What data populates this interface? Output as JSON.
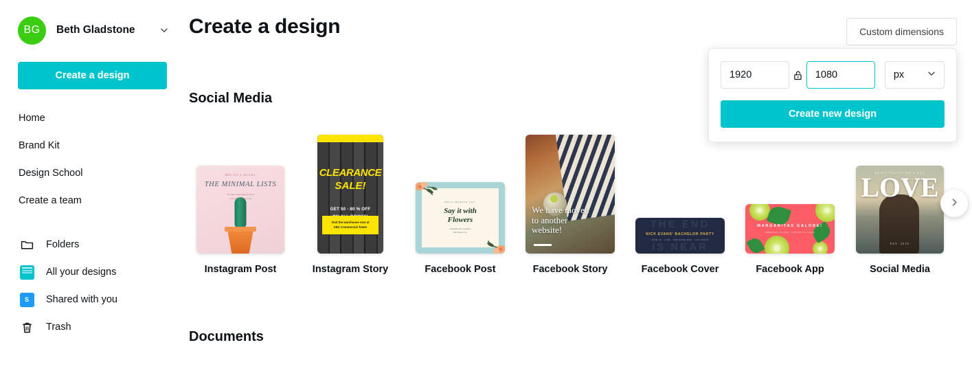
{
  "sidebar": {
    "user": {
      "initials": "BG",
      "name": "Beth Gladstone",
      "avatar_color": "#3ACD12",
      "caret_icon": "chevron-down-icon"
    },
    "cta_label": "Create a design",
    "links": [
      {
        "label": "Home"
      },
      {
        "label": "Brand Kit"
      },
      {
        "label": "Design School"
      },
      {
        "label": "Create a team"
      }
    ],
    "icon_links": [
      {
        "label": "Folders",
        "icon": "folder-icon"
      },
      {
        "label": "All your designs",
        "icon": "designs-icon"
      },
      {
        "label": "Shared with you",
        "icon": "shared-icon",
        "badge": "S"
      },
      {
        "label": "Trash",
        "icon": "trash-icon"
      }
    ]
  },
  "main": {
    "page_title": "Create a design",
    "custom_dimensions_label": "Custom dimensions",
    "sections": [
      {
        "title": "Social Media"
      },
      {
        "title": "Documents"
      }
    ],
    "next_arrow_icon": "chevron-right-icon"
  },
  "popup": {
    "width_value": "1920",
    "height_value": "1080",
    "lock_icon": "unlock-icon",
    "unit_value": "px",
    "unit_caret_icon": "chevron-down-icon",
    "create_label": "Create new design",
    "focused_field": "height"
  },
  "templates": [
    {
      "label": "Instagram Post",
      "art": {
        "header": "MELISA'S BOOKS",
        "title": "THE MINIMAL LISTS",
        "subtitle": "The Most Interesting Podcast\nwww.minimallists.com"
      }
    },
    {
      "label": "Instagram Story",
      "art": {
        "line1": "CLEARANCE",
        "line2": "SALE!",
        "offer": "GET 50 - 80 % OFF\nON ALL BOOKS!",
        "box": "Visit the warehouse now at\nABC Commercial Tower"
      }
    },
    {
      "label": "Facebook Post",
      "art": {
        "header": "MELS MOBILE TAG",
        "title": "Say it with\nFlowers",
        "subtitle": "Celebrate the occasion\nwith Flower Co."
      }
    },
    {
      "label": "Facebook Story",
      "art": {
        "text": "We have moved\nto another\nwebsite!"
      }
    },
    {
      "label": "Facebook Cover",
      "art": {
        "ghost_top": "THE END",
        "ghost_bottom": "IS NEAR",
        "name": "NICK EVANS' BACHELOR PARTY",
        "date": "JUNE 20 . 9 PM . THE ROSE BAR . LOS VEGAS"
      }
    },
    {
      "label": "Facebook App",
      "art": {
        "title": "MARGARITAS GALORE!",
        "subtitle": "FEBRUARY 21 2020 . 6:00 PM TILL LATE"
      }
    },
    {
      "label": "Social Media",
      "art": {
        "header": "HAPPY VALENTINE'S DAY",
        "word": "LOVE",
        "footer": "EST. 2019"
      }
    }
  ],
  "colors": {
    "brand_teal": "#00C4CC",
    "avatar_green": "#3ACD12",
    "shared_blue": "#1D9BF6",
    "text_dark": "#0d1216",
    "border_gray": "#dcdfe3"
  }
}
